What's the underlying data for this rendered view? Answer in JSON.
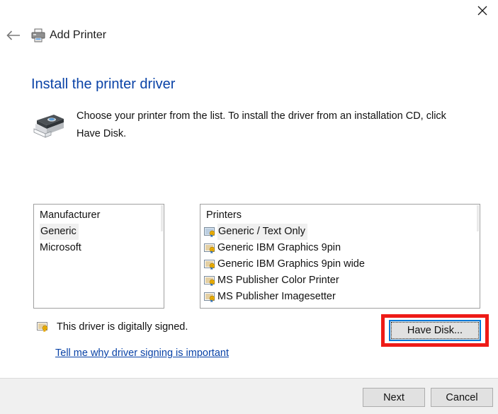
{
  "window": {
    "title": "Add Printer",
    "close_label": "✕",
    "back_label": "←",
    "printer_icon": "printer-icon"
  },
  "page": {
    "heading": "Install the printer driver",
    "instruction": "Choose your printer from the list. To install the driver from an installation CD, click Have Disk.",
    "illustration_icon": "printer-illustration-icon"
  },
  "manufacturer_list": {
    "header": "Manufacturer",
    "items": [
      {
        "label": "Generic",
        "selected": true
      },
      {
        "label": "Microsoft",
        "selected": false
      }
    ]
  },
  "printer_list": {
    "header": "Printers",
    "items": [
      {
        "label": "Generic / Text Only",
        "selected": true,
        "icon": "driver-certificate-icon"
      },
      {
        "label": "Generic IBM Graphics 9pin",
        "selected": false,
        "icon": "driver-certificate-icon"
      },
      {
        "label": "Generic IBM Graphics 9pin wide",
        "selected": false,
        "icon": "driver-certificate-icon"
      },
      {
        "label": "MS Publisher Color Printer",
        "selected": false,
        "icon": "driver-certificate-icon"
      },
      {
        "label": "MS Publisher Imagesetter",
        "selected": false,
        "icon": "driver-certificate-icon"
      }
    ]
  },
  "signature": {
    "icon": "driver-certificate-icon",
    "text": "This driver is digitally signed.",
    "link": "Tell me why driver signing is important"
  },
  "buttons": {
    "have_disk": "Have Disk...",
    "next": "Next",
    "cancel": "Cancel"
  },
  "annotation": {
    "highlight_target": "have-disk-button",
    "highlight_color": "#ee1b17"
  },
  "colors": {
    "heading_blue": "#0a43a7",
    "link_blue": "#0a43a7",
    "focus_blue": "#0078d7",
    "selection_gray": "#f0f0f0",
    "footer_gray": "#f0f0f0",
    "border_gray": "#a0a0a0"
  }
}
